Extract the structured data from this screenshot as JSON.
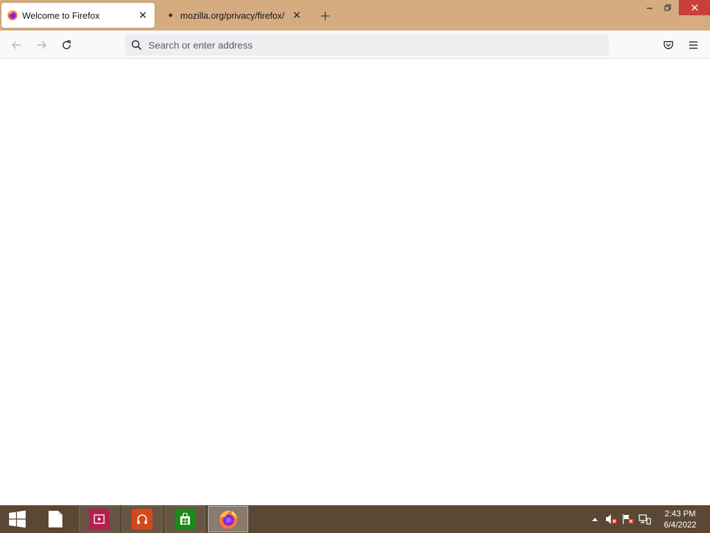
{
  "tabs": [
    {
      "title": "Welcome to Firefox",
      "active": true,
      "icon": "firefox-icon"
    },
    {
      "title": "mozilla.org/privacy/firefox/",
      "active": false,
      "icon": "dot-icon"
    }
  ],
  "tab_close_glyph": "✕",
  "urlbar": {
    "placeholder": "Search or enter address",
    "value": ""
  },
  "toolbar_icons": [
    "back-icon",
    "forward-icon",
    "reload-icon",
    "search-icon",
    "pocket-icon",
    "menu-icon"
  ],
  "taskbar": {
    "apps": [
      {
        "name": "start",
        "icon": "windows-icon"
      },
      {
        "name": "file",
        "icon": "file-icon"
      },
      {
        "name": "app-red",
        "icon": "photo-icon",
        "color": "#b4204f"
      },
      {
        "name": "app-orange",
        "icon": "headphones-icon",
        "color": "#d2491d"
      },
      {
        "name": "store",
        "icon": "store-icon",
        "color": "#1a8a1a"
      },
      {
        "name": "firefox",
        "icon": "firefox-icon",
        "active": true
      }
    ],
    "clock": {
      "time": "2:43 PM",
      "date": "6/4/2022"
    }
  },
  "colors": {
    "tabbar": "#d5ab80",
    "taskbar": "#5a4735",
    "close_button": "#c7413a"
  }
}
